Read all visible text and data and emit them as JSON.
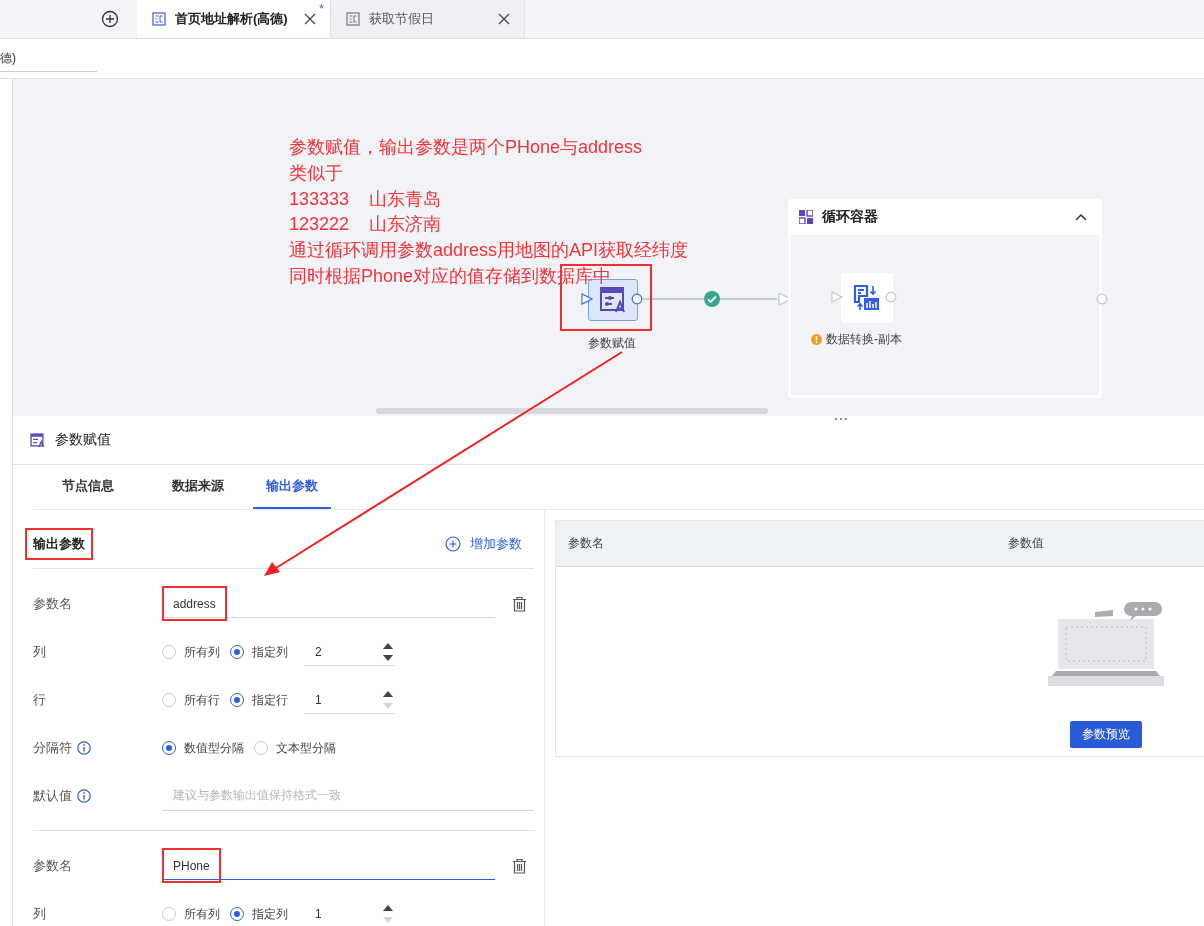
{
  "tabs": [
    {
      "label": "首页地址解析(高德)",
      "selected": true,
      "modified_mark": "*"
    },
    {
      "label": "获取节假日",
      "selected": false
    }
  ],
  "name_field": {
    "value": "德)"
  },
  "canvas": {
    "annotation_lines": [
      "参数赋值，输出参数是两个PHone与address",
      "类似于",
      "133333    山东青岛",
      "123222    山东济南",
      "通过循环调用参数address用地图的API获取经纬度",
      "同时根据Phone对应的值存储到数据库中"
    ],
    "source_node": {
      "label": "参数赋值",
      "highlighted": true
    },
    "link_ok": true,
    "container": {
      "title": "循环容器",
      "expanded": true,
      "node": {
        "label": "数据转换-副本",
        "warning": true
      }
    }
  },
  "panel": {
    "title": "参数赋值",
    "tabs": [
      {
        "label": "节点信息",
        "selected": false
      },
      {
        "label": "数据来源",
        "selected": false
      },
      {
        "label": "输出参数",
        "selected": true
      }
    ],
    "section_title": {
      "text": "输出参数",
      "highlighted": true
    },
    "add_button": "增加参数",
    "params": [
      {
        "name_label": "参数名",
        "name": "address",
        "focused": false,
        "highlighted": true,
        "fields": [
          {
            "kind": "radio-number",
            "label": "列",
            "options": [
              {
                "label": "所有列",
                "selected": false
              },
              {
                "label": "指定列",
                "selected": true
              }
            ],
            "value": "2",
            "can_decrease": true
          },
          {
            "kind": "radio-number",
            "label": "行",
            "options": [
              {
                "label": "所有行",
                "selected": false
              },
              {
                "label": "指定行",
                "selected": true
              }
            ],
            "value": "1",
            "can_decrease": false
          },
          {
            "kind": "radio",
            "label": "分隔符",
            "info": true,
            "options": [
              {
                "label": "数值型分隔",
                "selected": true
              },
              {
                "label": "文本型分隔",
                "selected": false
              }
            ]
          },
          {
            "kind": "text",
            "label": "默认值",
            "info": true,
            "placeholder": "建议与参数输出值保持格式一致"
          }
        ]
      },
      {
        "name_label": "参数名",
        "name": "PHone",
        "focused": true,
        "highlighted": true,
        "fields": [
          {
            "kind": "radio-number",
            "label": "列",
            "options": [
              {
                "label": "所有列",
                "selected": false
              },
              {
                "label": "指定列",
                "selected": true
              }
            ],
            "value": "1",
            "can_decrease": false
          }
        ]
      }
    ]
  },
  "preview": {
    "columns": [
      "参数名",
      "参数值"
    ],
    "button": "参数预览"
  }
}
